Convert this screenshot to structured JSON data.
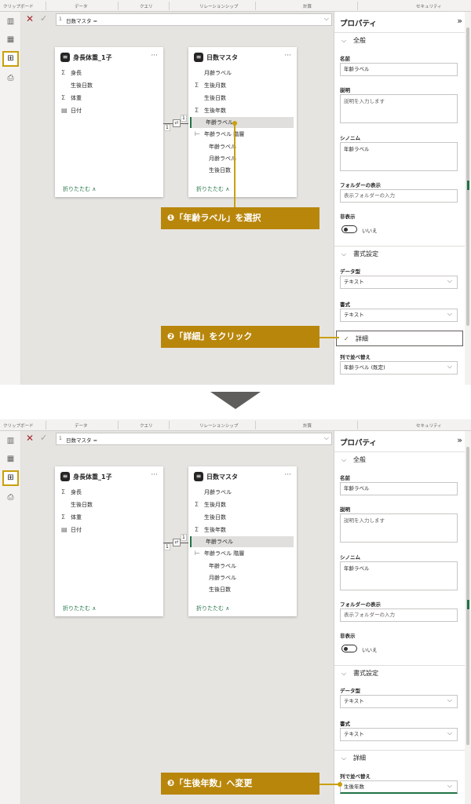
{
  "ribbon": {
    "groups": [
      "クリップボード",
      "データ",
      "クエリ",
      "リレーションシップ",
      "計算",
      "セキュリティ"
    ]
  },
  "formula_bar": {
    "line_number": "1",
    "text": "日数マスタ ="
  },
  "tables": [
    {
      "title": "身長体重_1子",
      "fields": [
        {
          "label": "身長",
          "icon": "sigma-icon"
        },
        {
          "label": "生後日数",
          "icon": ""
        },
        {
          "label": "体重",
          "icon": "sigma-icon"
        },
        {
          "label": "日付",
          "icon": "calendar-icon"
        }
      ],
      "collapse_label": "折りたたむ ∧"
    },
    {
      "title": "日数マスタ",
      "fields": [
        {
          "label": "月齢ラベル",
          "icon": ""
        },
        {
          "label": "生後月数",
          "icon": "sigma-icon"
        },
        {
          "label": "生後日数",
          "icon": ""
        },
        {
          "label": "生後年数",
          "icon": "sigma-icon"
        },
        {
          "label": "年齢ラベル",
          "icon": "",
          "selected": true
        },
        {
          "label": "年齢ラベル 階層",
          "icon": "hierarchy-icon"
        },
        {
          "label": "年齢ラベル",
          "icon": "",
          "sub": true
        },
        {
          "label": "月齢ラベル",
          "icon": "",
          "sub": true
        },
        {
          "label": "生後日数",
          "icon": "",
          "sub": true
        }
      ],
      "collapse_label": "折りたたむ ∧"
    }
  ],
  "relationship": {
    "left_cardinality": "1",
    "right_cardinality": "1"
  },
  "properties": {
    "header": "プロパティ",
    "section_general": "全般",
    "name_label": "名前",
    "name_value": "年齢ラベル",
    "description_label": "説明",
    "description_placeholder": "説明を入力します",
    "synonyms_label": "シノニム",
    "synonyms_value": "年齢ラベル",
    "folder_label": "フォルダーの表示",
    "folder_placeholder": "表示フォルダーの入力",
    "hidden_label": "非表示",
    "hidden_value": "いいえ",
    "section_format": "書式設定",
    "datatype_label": "データ型",
    "datatype_value": "テキスト",
    "format_label": "書式",
    "format_value": "テキスト",
    "section_advanced": "詳細",
    "sortby_label": "列で並べ替え",
    "sortby_before": "年齢ラベル (既定)",
    "sortby_after": "生後年数"
  },
  "callouts": {
    "step1": "❶「年齢ラベル」を選択",
    "step2": "❷「詳細」をクリック",
    "step3": "❸「生後年数」へ変更"
  }
}
